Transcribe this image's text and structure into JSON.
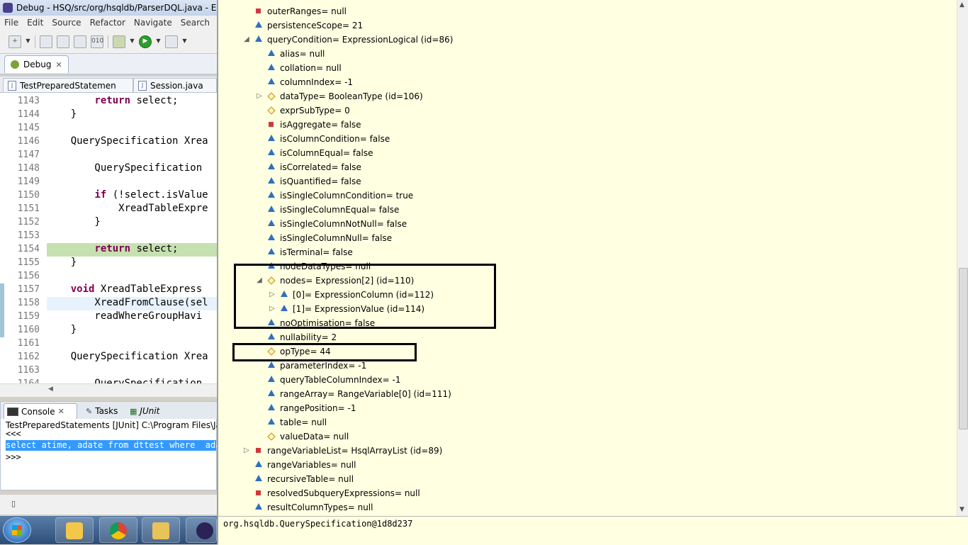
{
  "window": {
    "title": "Debug - HSQ/src/org/hsqldb/ParserDQL.java - Ec"
  },
  "menu": [
    "File",
    "Edit",
    "Source",
    "Refactor",
    "Navigate",
    "Search"
  ],
  "debug_view": {
    "tab": "Debug"
  },
  "editor_tabs": [
    "TestPreparedStatemen",
    "Session.java"
  ],
  "editor": {
    "lines": [
      {
        "n": "1143",
        "code": "        return select;"
      },
      {
        "n": "1144",
        "code": "    }"
      },
      {
        "n": "1145",
        "code": ""
      },
      {
        "n": "1146",
        "code": "    QuerySpecification Xrea"
      },
      {
        "n": "1147",
        "code": ""
      },
      {
        "n": "1148",
        "code": "        QuerySpecification "
      },
      {
        "n": "1149",
        "code": ""
      },
      {
        "n": "1150",
        "code": "        if (!select.isValue"
      },
      {
        "n": "1151",
        "code": "            XreadTableExpre"
      },
      {
        "n": "1152",
        "code": "        }"
      },
      {
        "n": "1153",
        "code": ""
      },
      {
        "n": "1154",
        "code": "        return select;"
      },
      {
        "n": "1155",
        "code": "    }"
      },
      {
        "n": "1156",
        "code": ""
      },
      {
        "n": "1157",
        "code": "    void XreadTableExpress"
      },
      {
        "n": "1158",
        "code": "        XreadFromClause(sel"
      },
      {
        "n": "1159",
        "code": "        readWhereGroupHavi"
      },
      {
        "n": "1160",
        "code": "    }"
      },
      {
        "n": "1161",
        "code": ""
      },
      {
        "n": "1162",
        "code": "    QuerySpecification Xrea"
      },
      {
        "n": "1163",
        "code": ""
      },
      {
        "n": "1164",
        "code": "        QuerySpecification "
      }
    ]
  },
  "console": {
    "tabs": [
      "Console",
      "Tasks",
      "JUnit"
    ],
    "launch": "TestPreparedStatements [JUnit] C:\\Program Files\\Ja",
    "lines": [
      "<<<",
      "select atime, adate from dttest where  ada",
      ">>>"
    ]
  },
  "variables": [
    {
      "depth": 0,
      "icon": "sq",
      "expand": "",
      "label": "outerRanges= null"
    },
    {
      "depth": 0,
      "icon": "tri",
      "expand": "",
      "label": "persistenceScope= 21"
    },
    {
      "depth": 0,
      "icon": "tri",
      "expand": "open",
      "label": "queryCondition= ExpressionLogical  (id=86)"
    },
    {
      "depth": 1,
      "icon": "tri",
      "expand": "",
      "label": "alias= null"
    },
    {
      "depth": 1,
      "icon": "tri",
      "expand": "",
      "label": "collation= null"
    },
    {
      "depth": 1,
      "icon": "tri",
      "expand": "",
      "label": "columnIndex= -1"
    },
    {
      "depth": 1,
      "icon": "dia",
      "expand": "closed",
      "label": "dataType= BooleanType  (id=106)"
    },
    {
      "depth": 1,
      "icon": "dia",
      "expand": "",
      "label": "exprSubType= 0"
    },
    {
      "depth": 1,
      "icon": "sq",
      "expand": "",
      "label": "isAggregate= false"
    },
    {
      "depth": 1,
      "icon": "tri",
      "expand": "",
      "label": "isColumnCondition= false"
    },
    {
      "depth": 1,
      "icon": "tri",
      "expand": "",
      "label": "isColumnEqual= false"
    },
    {
      "depth": 1,
      "icon": "tri",
      "expand": "",
      "label": "isCorrelated= false"
    },
    {
      "depth": 1,
      "icon": "tri",
      "expand": "",
      "label": "isQuantified= false"
    },
    {
      "depth": 1,
      "icon": "tri",
      "expand": "",
      "label": "isSingleColumnCondition= true"
    },
    {
      "depth": 1,
      "icon": "tri",
      "expand": "",
      "label": "isSingleColumnEqual= false"
    },
    {
      "depth": 1,
      "icon": "tri",
      "expand": "",
      "label": "isSingleColumnNotNull= false"
    },
    {
      "depth": 1,
      "icon": "tri",
      "expand": "",
      "label": "isSingleColumnNull= false"
    },
    {
      "depth": 1,
      "icon": "tri",
      "expand": "",
      "label": "isTerminal= false"
    },
    {
      "depth": 1,
      "icon": "tri",
      "expand": "",
      "label": "nodeDataTypes= null"
    },
    {
      "depth": 1,
      "icon": "dia",
      "expand": "open",
      "label": "nodes= Expression[2]  (id=110)"
    },
    {
      "depth": 2,
      "icon": "tri",
      "expand": "closed",
      "label": "[0]= ExpressionColumn  (id=112)"
    },
    {
      "depth": 2,
      "icon": "tri",
      "expand": "closed",
      "label": "[1]= ExpressionValue  (id=114)"
    },
    {
      "depth": 1,
      "icon": "tri",
      "expand": "",
      "label": "noOptimisation= false"
    },
    {
      "depth": 1,
      "icon": "tri",
      "expand": "",
      "label": "nullability= 2"
    },
    {
      "depth": 1,
      "icon": "dia",
      "expand": "",
      "label": "opType= 44"
    },
    {
      "depth": 1,
      "icon": "tri",
      "expand": "",
      "label": "parameterIndex= -1"
    },
    {
      "depth": 1,
      "icon": "tri",
      "expand": "",
      "label": "queryTableColumnIndex= -1"
    },
    {
      "depth": 1,
      "icon": "tri",
      "expand": "",
      "label": "rangeArray= RangeVariable[0]  (id=111)"
    },
    {
      "depth": 1,
      "icon": "tri",
      "expand": "",
      "label": "rangePosition= -1"
    },
    {
      "depth": 1,
      "icon": "tri",
      "expand": "",
      "label": "table= null"
    },
    {
      "depth": 1,
      "icon": "dia",
      "expand": "",
      "label": "valueData= null"
    },
    {
      "depth": 0,
      "icon": "sq",
      "expand": "closed",
      "label": "rangeVariableList= HsqlArrayList  (id=89)"
    },
    {
      "depth": 0,
      "icon": "tri",
      "expand": "",
      "label": "rangeVariables= null"
    },
    {
      "depth": 0,
      "icon": "tri",
      "expand": "",
      "label": "recursiveTable= null"
    },
    {
      "depth": 0,
      "icon": "sq",
      "expand": "",
      "label": "resolvedSubqueryExpressions= null"
    },
    {
      "depth": 0,
      "icon": "tri",
      "expand": "",
      "label": "resultColumnTypes= null"
    }
  ],
  "detail": {
    "text": "org.hsqldb.QuerySpecification@1d8d237"
  },
  "colors": {
    "popup_bg": "#ffffe1",
    "keyword": "#7f0055",
    "current_line": "#c7e0b0",
    "selection": "#3399ff"
  },
  "icons": {
    "field_public": "blue-triangle-icon",
    "field_private": "red-square-icon",
    "field_default": "yellow-diamond-icon"
  }
}
